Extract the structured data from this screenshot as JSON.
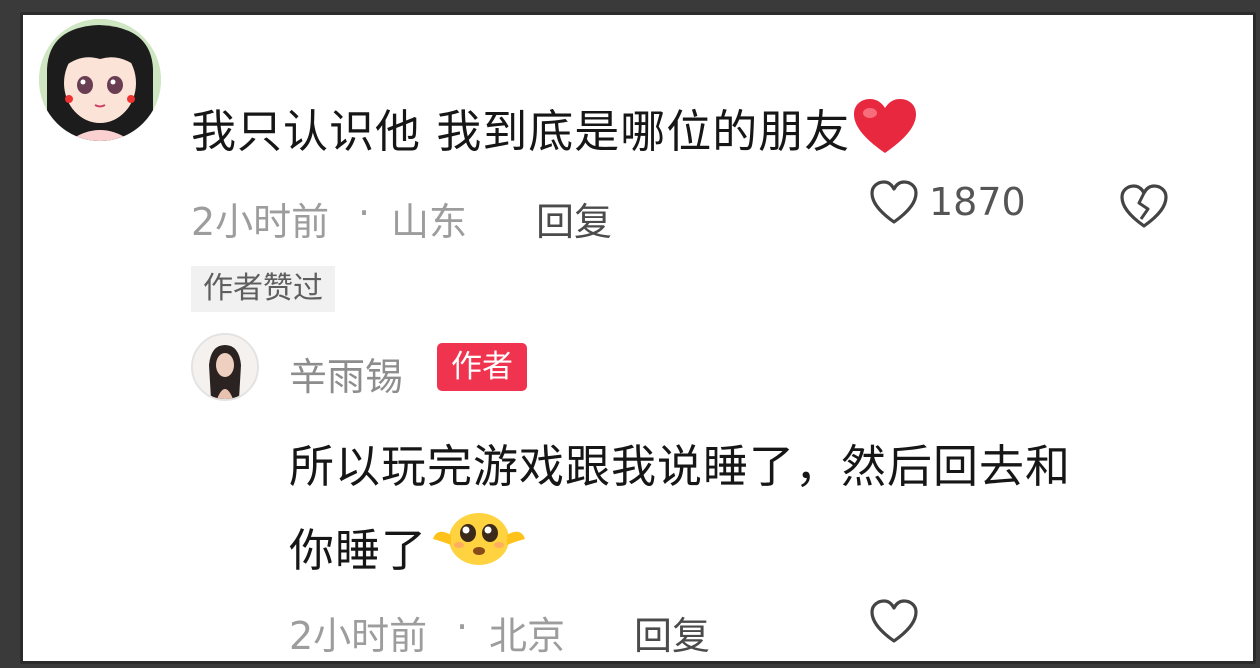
{
  "comment": {
    "text": "我只认识他 我到底是哪位的朋友",
    "emoji": "red-heart",
    "time": "2小时前",
    "separator": "·",
    "location": "山东",
    "reply_label": "回复",
    "like_count": "1870",
    "liked_by_author": "作者赞过"
  },
  "reply": {
    "username": "辛雨锡",
    "author_tag": "作者",
    "text_line1": "所以玩完游戏跟我说睡了，然后回去和",
    "text_line2": "你睡了",
    "emoji": "pleading-face",
    "time": "2小时前",
    "separator": "·",
    "location": "北京",
    "reply_label": "回复"
  },
  "colors": {
    "author_tag_bg": "#f0344f",
    "meta_text": "#9d9d9d",
    "heart_red": "#e8283f"
  }
}
